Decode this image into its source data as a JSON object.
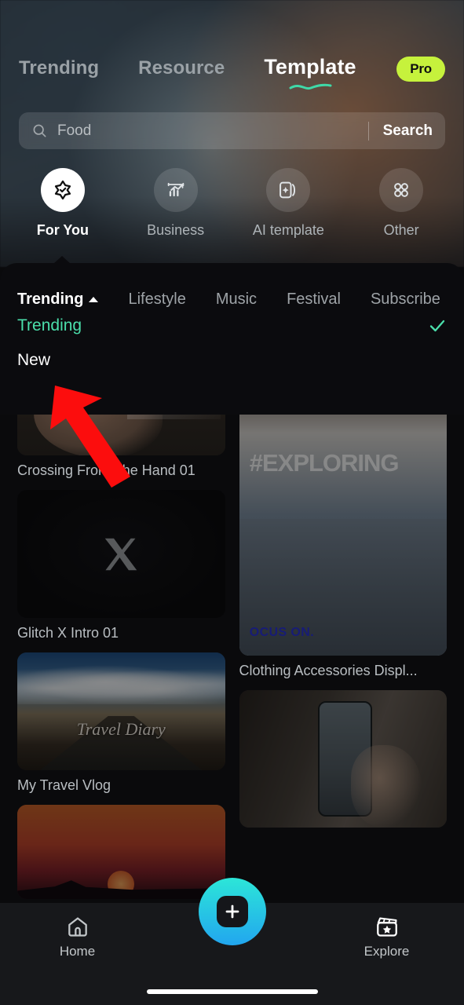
{
  "header": {
    "tabs": [
      {
        "label": "Trending",
        "active": false
      },
      {
        "label": "Resource",
        "active": false
      },
      {
        "label": "Template",
        "active": true
      }
    ],
    "pro_badge": "Pro"
  },
  "search": {
    "placeholder": "Food",
    "value": "",
    "button_label": "Search",
    "icon": "search-icon"
  },
  "categories": [
    {
      "label": "For You",
      "icon": "star-check-icon",
      "active": true
    },
    {
      "label": "Business",
      "icon": "bar-chart-trend-icon",
      "active": false
    },
    {
      "label": "AI template",
      "icon": "cards-sparkle-icon",
      "active": false
    },
    {
      "label": "Other",
      "icon": "grid-four-icon",
      "active": false
    }
  ],
  "dropdown": {
    "tabs": [
      {
        "label": "Trending",
        "active": true,
        "caret": "caret-up-icon"
      },
      {
        "label": "Lifestyle",
        "active": false
      },
      {
        "label": "Music",
        "active": false
      },
      {
        "label": "Festival",
        "active": false
      },
      {
        "label": "Subscribe",
        "active": false
      }
    ],
    "options": [
      {
        "label": "Trending",
        "selected": true,
        "check_icon": "check-icon"
      },
      {
        "label": "New",
        "selected": false
      }
    ]
  },
  "templates": {
    "left_column": [
      {
        "title": "Crossing From The Hand 01",
        "art": "hand"
      },
      {
        "title": "Glitch X Intro 01",
        "art": "x-logo"
      },
      {
        "title": "My Travel Vlog",
        "art": "travel-diary",
        "overlay_text": "Travel Diary"
      },
      {
        "title": "",
        "art": "sunset"
      }
    ],
    "right_column": [
      {
        "title": "Clothing Accessories Displ...",
        "art": "exploring",
        "overlay_text": "#EXPLORING",
        "secondary_text": "OCUS ON."
      },
      {
        "title": "",
        "art": "phone-in-hand"
      }
    ]
  },
  "bottom_nav": {
    "items": [
      {
        "label": "Home",
        "icon": "home-icon"
      },
      {
        "label": "Explore",
        "icon": "clapperboard-star-icon"
      }
    ],
    "create_button": {
      "icon": "plus-icon",
      "label": ""
    }
  },
  "annotation": {
    "type": "red-arrow",
    "points_to": "New"
  },
  "colors": {
    "accent_teal": "#4bdfab",
    "pro_green": "#c6f23c",
    "fab_gradient_start": "#2ce6d8",
    "fab_gradient_end": "#22a6ef",
    "arrow_red": "#fc0d0d",
    "panel_bg": "#0b0b0e"
  }
}
